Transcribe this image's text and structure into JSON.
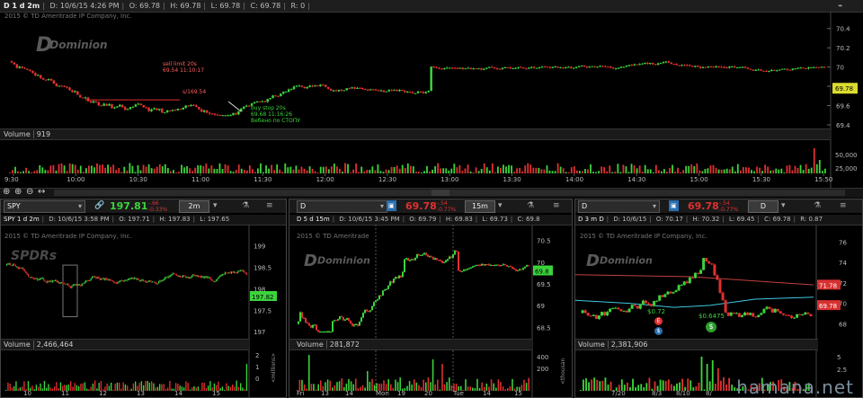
{
  "top": {
    "header": {
      "symbol": "D 1 d 2m",
      "date": "D: 10/6/15 4:26 PM",
      "open": "O: 69.78",
      "high": "H: 69.78",
      "low": "L: 69.78",
      "close": "C: 69.78",
      "range": "R: 0"
    },
    "copyright": "2015 © TD Ameritrade IP Company, Inc.",
    "logo": "Dominion",
    "price_label": "69.78",
    "yticks": [
      "70.4",
      "70.2",
      "70",
      "69.8",
      "69.6",
      "69.4"
    ],
    "xticks": [
      "9:30",
      "10:00",
      "10:30",
      "11:00",
      "11:30",
      "12:00",
      "12:30",
      "13:00",
      "13:30",
      "14:00",
      "14:30",
      "15:00",
      "15:30",
      "15:50"
    ],
    "vol_ticks": [
      "50,000",
      "25,000"
    ],
    "volume_label": "Volume",
    "volume_value": "919",
    "annotations": {
      "sell": [
        "sell limit 20s",
        "69.54 11:10:17"
      ],
      "level": "s/169.54",
      "buy": [
        "buy stop 20s",
        "69.68 11:16:26",
        "Вебено по СТОПУ"
      ]
    }
  },
  "spy": {
    "symbol": "SPY",
    "price": "197.81",
    "chg1": "-.66",
    "chg2": "-0.33%",
    "timeframe": "2m",
    "header": {
      "sym": "SPY 1 d 2m",
      "date": "D: 10/6/15 3:58 PM",
      "open": "O: 197.71",
      "high": "H: 197.83",
      "low": "L: 197.65"
    },
    "copyright": "2015 © TD Ameritrade IP Company, Inc.",
    "logo": "SPDRs",
    "price_label": "197.82",
    "yticks": [
      "199",
      "198.5",
      "198",
      "197.5",
      "197"
    ],
    "xticks": [
      "10",
      "11",
      "12",
      "13",
      "14",
      "15"
    ],
    "volume_label": "Volume",
    "volume_value": "2,466,464",
    "vol_ticks": [
      "2",
      "1",
      "0"
    ],
    "vol_unit": "<millions>"
  },
  "d15": {
    "symbol": "D",
    "price": "69.78",
    "chg1": "-.54",
    "chg2": "-0.77%",
    "timeframe": "15m",
    "header": {
      "sym": "D 5 d 15m",
      "date": "D: 10/6/15 3:45 PM",
      "open": "O: 69.79",
      "high": "H: 69.83",
      "low": "L: 69.73",
      "close": "C: 69.8"
    },
    "copyright": "2015 © TD Ameritrade",
    "logo": "Dominion",
    "price_label": "69.8",
    "yticks": [
      "70.5",
      "70",
      "69.5",
      "69",
      "68.5"
    ],
    "xticks": [
      "Fri",
      "13",
      "14",
      "Mon",
      "19",
      "20",
      "Tue",
      "14",
      "15"
    ],
    "volume_label": "Volume",
    "volume_value": "281,872",
    "vol_ticks": [
      "400",
      "200"
    ],
    "vol_unit": "<thousan"
  },
  "d3m": {
    "symbol": "D",
    "price": "69.78",
    "chg1": "-.54",
    "chg2": "-0.77%",
    "timeframe": "D",
    "header": {
      "sym": "D 3 m D",
      "date": "D: 10/6/15",
      "open": "O: 70.17",
      "high": "H: 70.32",
      "low": "L: 69.45",
      "close": "C: 69.78",
      "range": "R: 0.87"
    },
    "copyright": "2015 © TD Ameritrade IP Company, Inc.",
    "logo": "Dominion",
    "price_labels": [
      "71.78",
      "69.78"
    ],
    "yticks": [
      "76",
      "74",
      "72",
      "70",
      "68"
    ],
    "xticks": [
      "7/20",
      "8/3",
      "8/10",
      "8/"
    ],
    "events": [
      "$0.72",
      "$0.6475"
    ],
    "volume_label": "Volume",
    "volume_value": "2,381,906",
    "vol_ticks": [
      "5",
      "2.5"
    ]
  },
  "watermark": "hamana.net",
  "colors": {
    "up": "#3cd43c",
    "down": "#e03030",
    "bg": "#000000",
    "level": "#e03030",
    "sma": "#40c8e0",
    "grid": "#333333"
  }
}
